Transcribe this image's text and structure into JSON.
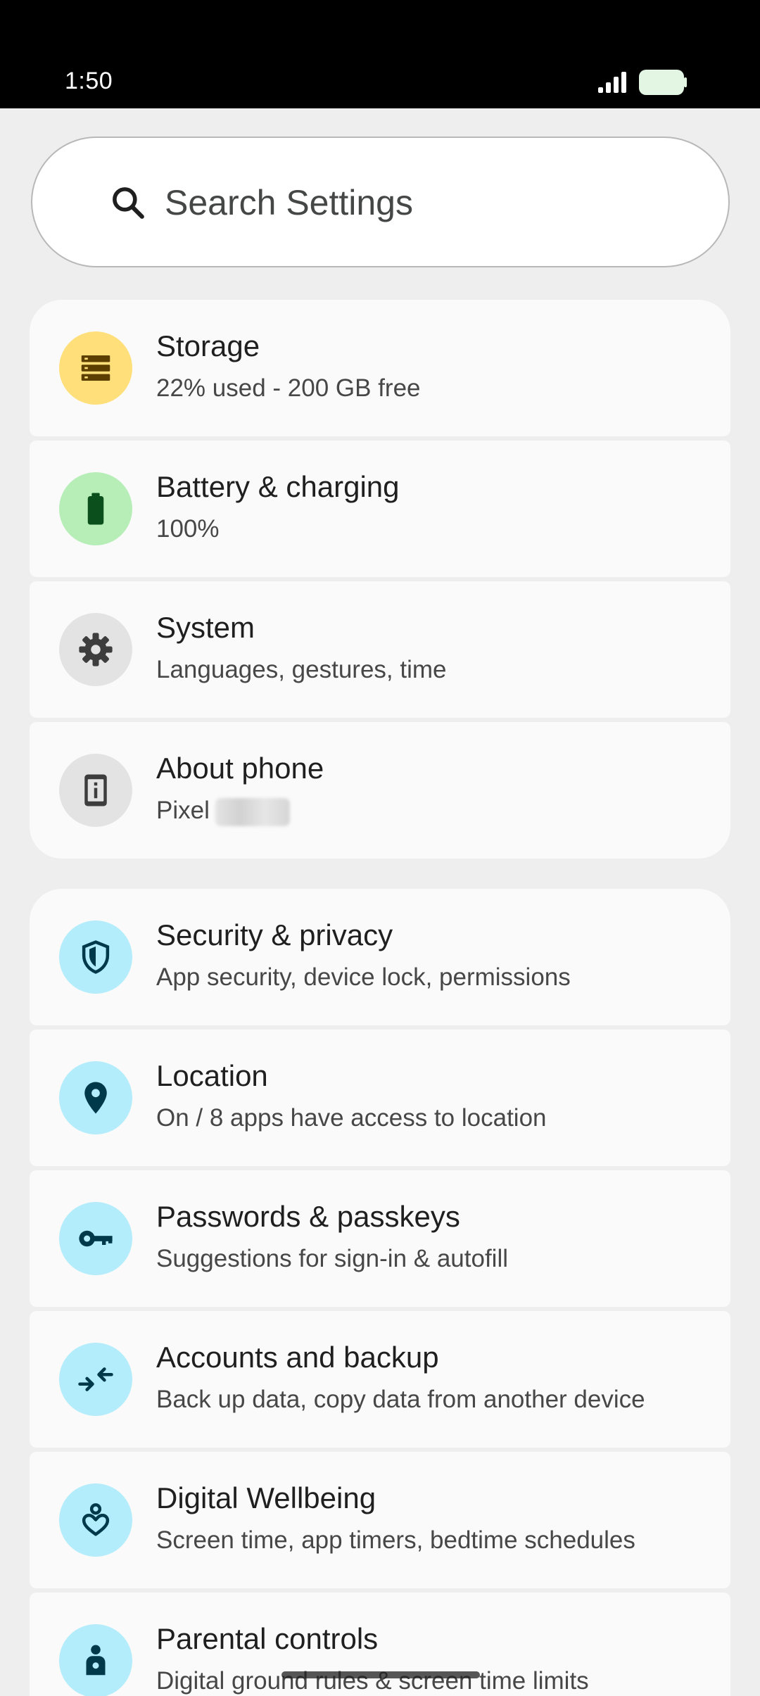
{
  "status_bar": {
    "time": "1:50",
    "icons": [
      "signal-icon",
      "battery-icon"
    ]
  },
  "search": {
    "placeholder": "Search Settings",
    "icon": "search-icon"
  },
  "groups": [
    {
      "items": [
        {
          "title": "Storage",
          "subtitle": "22% used - 200 GB free",
          "icon": "storage-icon",
          "icon_bg": "#ffdf7a",
          "icon_fg": "#5c3f00"
        },
        {
          "title": "Battery & charging",
          "subtitle": "100%",
          "icon": "battery-full-icon",
          "icon_bg": "#b7eeb8",
          "icon_fg": "#0a4f1c"
        },
        {
          "title": "System",
          "subtitle": "Languages, gestures, time",
          "icon": "gear-icon",
          "icon_bg": "#e3e3e3",
          "icon_fg": "#3d3d3d"
        },
        {
          "title": "About phone",
          "subtitle": "Pixel",
          "icon": "phone-info-icon",
          "icon_bg": "#e3e3e3",
          "icon_fg": "#3d3d3d"
        }
      ]
    },
    {
      "items": [
        {
          "title": "Security & privacy",
          "subtitle": "App security, device lock, permissions",
          "icon": "shield-icon",
          "icon_bg": "#b3ecfb",
          "icon_fg": "#00394a"
        },
        {
          "title": "Location",
          "subtitle": "On / 8 apps have access to location",
          "icon": "location-pin-icon",
          "icon_bg": "#b3ecfb",
          "icon_fg": "#00394a"
        },
        {
          "title": "Passwords & passkeys",
          "subtitle": "Suggestions for sign-in & autofill",
          "icon": "key-icon",
          "icon_bg": "#b3ecfb",
          "icon_fg": "#00394a"
        },
        {
          "title": "Accounts and backup",
          "subtitle": "Back up data, copy data from another device",
          "icon": "sync-arrows-icon",
          "icon_bg": "#b3ecfb",
          "icon_fg": "#00394a"
        },
        {
          "title": "Digital Wellbeing",
          "subtitle": "Screen time, app timers, bedtime schedules",
          "icon": "wellbeing-heart-icon",
          "icon_bg": "#b3ecfb",
          "icon_fg": "#00394a"
        },
        {
          "title": "Parental controls",
          "subtitle": "Digital ground rules & screen time limits",
          "icon": "parental-controls-icon",
          "icon_bg": "#b3ecfb",
          "icon_fg": "#00394a"
        }
      ]
    }
  ]
}
